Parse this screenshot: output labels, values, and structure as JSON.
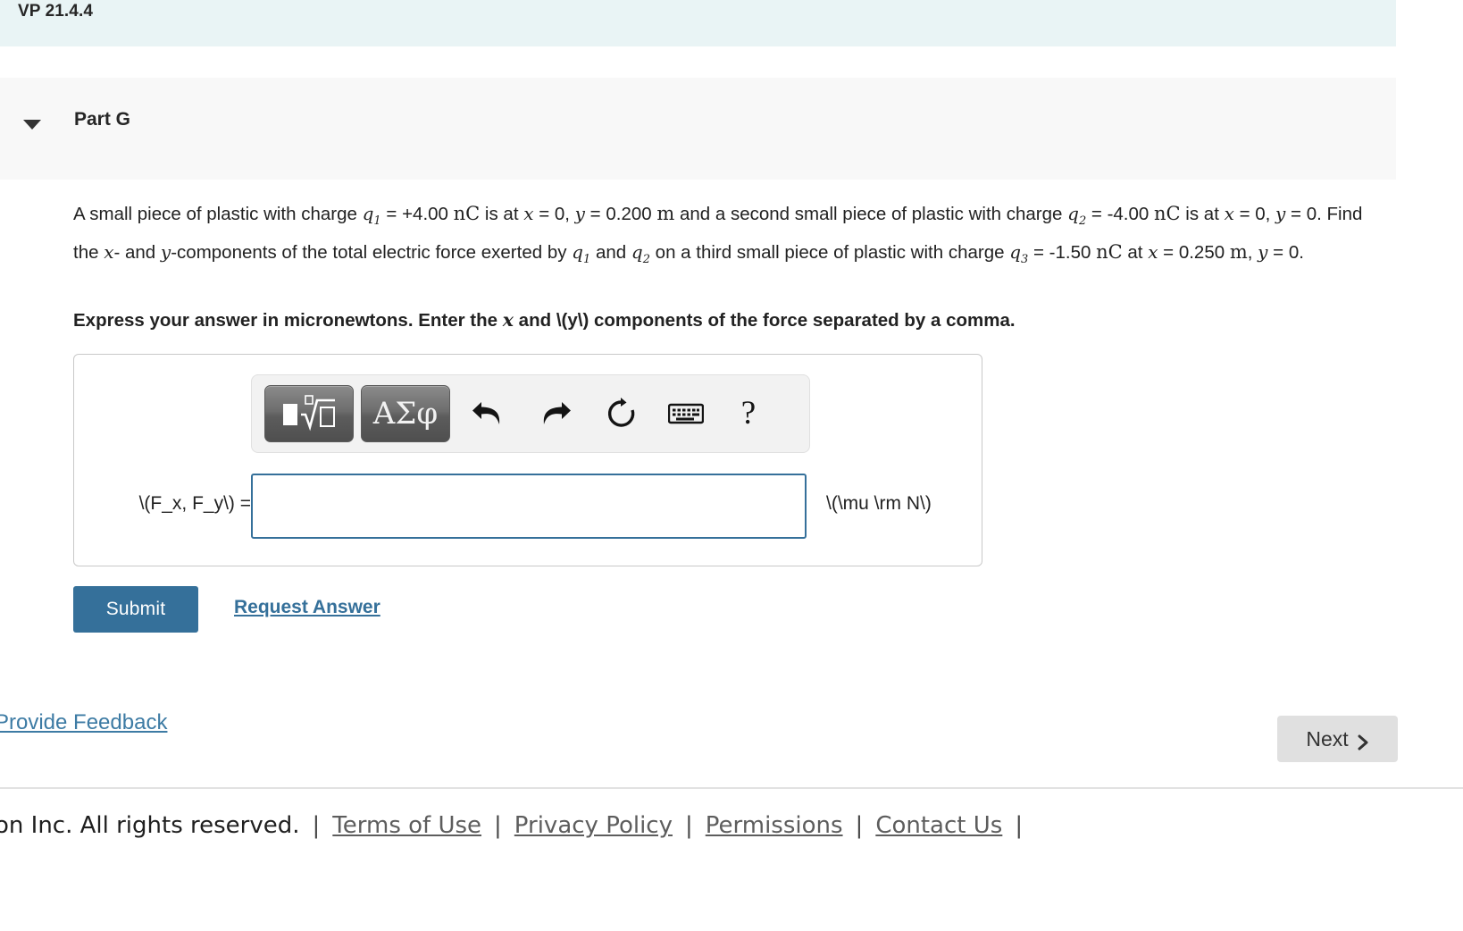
{
  "header": {
    "title": "VP 21.4.4"
  },
  "part": {
    "caret_icon": "caret-down-icon",
    "label": "Part G"
  },
  "problem": {
    "line1_a": "A small piece of plastic with charge ",
    "q1": "q",
    "q1_sub": "1",
    "line1_b": " = +4.00 ",
    "nC": "nC",
    "line1_c": " is at ",
    "x": "x",
    "line1_d": " = 0, ",
    "y": "y",
    "line1_e": " = 0.200 ",
    "m": "m",
    "line1_f": " and a second small piece of plastic with charge ",
    "q2": "q",
    "q2_sub": "2",
    "line2_a": " = -4.00 ",
    "line2_b": " is at ",
    "line2_c": " = 0, ",
    "line2_d": " = 0. Find the ",
    "line2_e": "- and ",
    "line2_f": "-components of the total electric force exerted by ",
    "line2_g": " and ",
    "line2_h": " on a third small piece of plastic with charge ",
    "q3": "q",
    "q3_sub": "3",
    "line3_a": " = -1.50 ",
    "line3_b": " at ",
    "line3_c": " = 0.250 ",
    "line3_d": ", ",
    "line3_e": " = 0."
  },
  "instruction": {
    "text_a": "Express your answer in micronewtons. Enter the ",
    "italic_x": "x",
    "text_b": " and \\(y\\) components of the force separated by a comma."
  },
  "toolbar": {
    "template_button": "template-matrix-icon",
    "greek_button": "ΑΣφ",
    "undo_icon": "undo-icon",
    "redo_icon": "redo-icon",
    "reset_icon": "reset-icon",
    "keyboard_icon": "keyboard-icon",
    "help_icon": "?"
  },
  "answer": {
    "label": "\\(F_x, F_y\\) =",
    "value": "",
    "placeholder": "",
    "unit": "\\(\\mu \\rm N\\)"
  },
  "actions": {
    "submit_label": "Submit",
    "request_answer_label": "Request Answer"
  },
  "navigation": {
    "provide_feedback_label": "Provide Feedback",
    "next_label": "Next",
    "next_chevron_icon": "chevron-right-icon"
  },
  "footer": {
    "copyright": "on Inc. All rights reserved.",
    "separator": "|",
    "links": [
      "Terms of Use",
      "Privacy Policy",
      "Permissions",
      "Contact Us"
    ]
  },
  "colors": {
    "header_bg": "#e9f4f5",
    "part_bg": "#f8f8f8",
    "accent": "#35709a",
    "link": "#3d7ba4",
    "next_bg": "#e0e0e0"
  }
}
